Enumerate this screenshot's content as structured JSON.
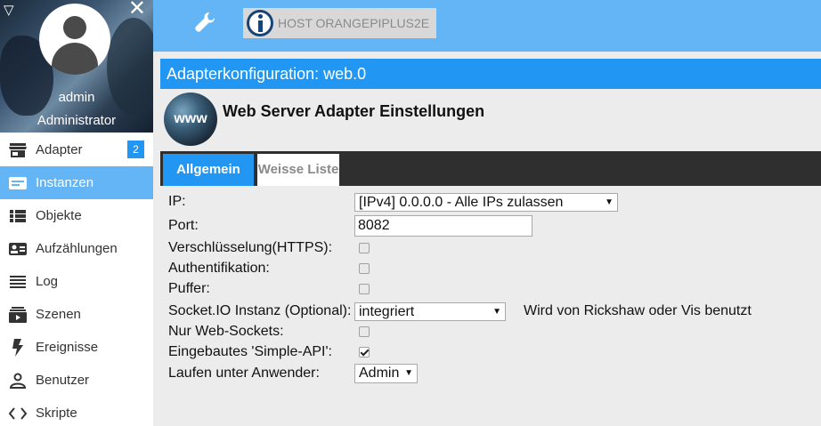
{
  "sidebar": {
    "user": {
      "name": "admin",
      "role": "Administrator"
    },
    "menu_toggle": "▽",
    "close": "✕",
    "items": [
      {
        "label": "Adapter",
        "icon": "store-icon",
        "badge": "2",
        "active": false
      },
      {
        "label": "Instanzen",
        "icon": "instances-icon",
        "active": true
      },
      {
        "label": "Objekte",
        "icon": "list-view-icon",
        "active": false
      },
      {
        "label": "Aufzählungen",
        "icon": "contact-card-icon",
        "active": false
      },
      {
        "label": "Log",
        "icon": "lines-icon",
        "active": false
      },
      {
        "label": "Szenen",
        "icon": "subscriptions-icon",
        "active": false
      },
      {
        "label": "Ereignisse",
        "icon": "flash-icon",
        "active": false
      },
      {
        "label": "Benutzer",
        "icon": "person-icon",
        "active": false
      },
      {
        "label": "Skripte",
        "icon": "code-icon",
        "active": false
      }
    ]
  },
  "topbar": {
    "host_label": "HOST ORANGEPIPLUS2E"
  },
  "config": {
    "title": "Adapterkonfiguration: web.0",
    "adapter_logo_text": "www",
    "header": "Web Server Adapter Einstellungen",
    "tabs": [
      {
        "label": "Allgemein",
        "active": true
      },
      {
        "label": "Weisse Liste",
        "active": false
      }
    ],
    "fields": {
      "ip": {
        "label": "IP:",
        "value": "[IPv4] 0.0.0.0 - Alle IPs zulassen"
      },
      "port": {
        "label": "Port:",
        "value": "8082"
      },
      "https": {
        "label": "Verschlüsselung(HTTPS):",
        "checked": false
      },
      "auth": {
        "label": "Authentifikation:",
        "checked": false
      },
      "cache": {
        "label": "Puffer:",
        "checked": false
      },
      "socketio": {
        "label": "Socket.IO Instanz (Optional):",
        "value": "integriert",
        "note": "Wird von Rickshaw oder Vis benutzt"
      },
      "websockets": {
        "label": "Nur Web-Sockets:",
        "checked": false
      },
      "simpleapi": {
        "label": "Eingebautes 'Simple-API':",
        "checked": true
      },
      "run_as": {
        "label": "Laufen unter Anwender:",
        "value": "Admin"
      }
    }
  },
  "colors": {
    "accent": "#2196f3",
    "topbar": "#64b5f6",
    "tabbar": "#2f2f2f"
  }
}
